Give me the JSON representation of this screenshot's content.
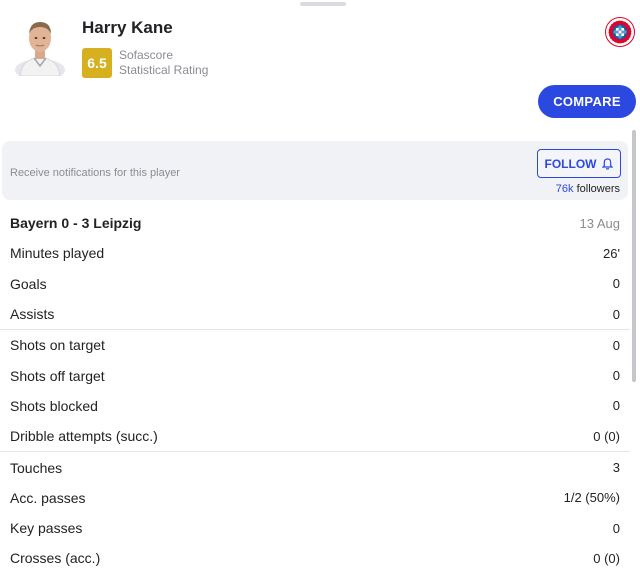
{
  "player": {
    "name": "Harry Kane",
    "rating": "6.5",
    "rating_source": "Sofascore",
    "rating_label": "Statistical Rating"
  },
  "actions": {
    "compare_label": "COMPARE",
    "notify_text": "Receive notifications for this player",
    "follow_label": "FOLLOW",
    "followers_count": "76k",
    "followers_label": "followers"
  },
  "match": {
    "title": "Bayern 0 - 3 Leipzig",
    "date": "13 Aug"
  },
  "stat_groups": [
    [
      {
        "label": "Minutes played",
        "value": "26'"
      },
      {
        "label": "Goals",
        "value": "0"
      },
      {
        "label": "Assists",
        "value": "0"
      }
    ],
    [
      {
        "label": "Shots on target",
        "value": "0"
      },
      {
        "label": "Shots off target",
        "value": "0"
      },
      {
        "label": "Shots blocked",
        "value": "0"
      },
      {
        "label": "Dribble attempts (succ.)",
        "value": "0 (0)"
      }
    ],
    [
      {
        "label": "Touches",
        "value": "3"
      },
      {
        "label": "Acc. passes",
        "value": "1/2 (50%)"
      },
      {
        "label": "Key passes",
        "value": "0"
      },
      {
        "label": "Crosses (acc.)",
        "value": "0 (0)"
      }
    ]
  ],
  "colors": {
    "accent": "#2b48e0",
    "rating_badge": "#d6b01f",
    "club_red": "#dc052d"
  },
  "icons": {
    "bell": "bell-icon",
    "club": "fc-bayern-logo"
  }
}
